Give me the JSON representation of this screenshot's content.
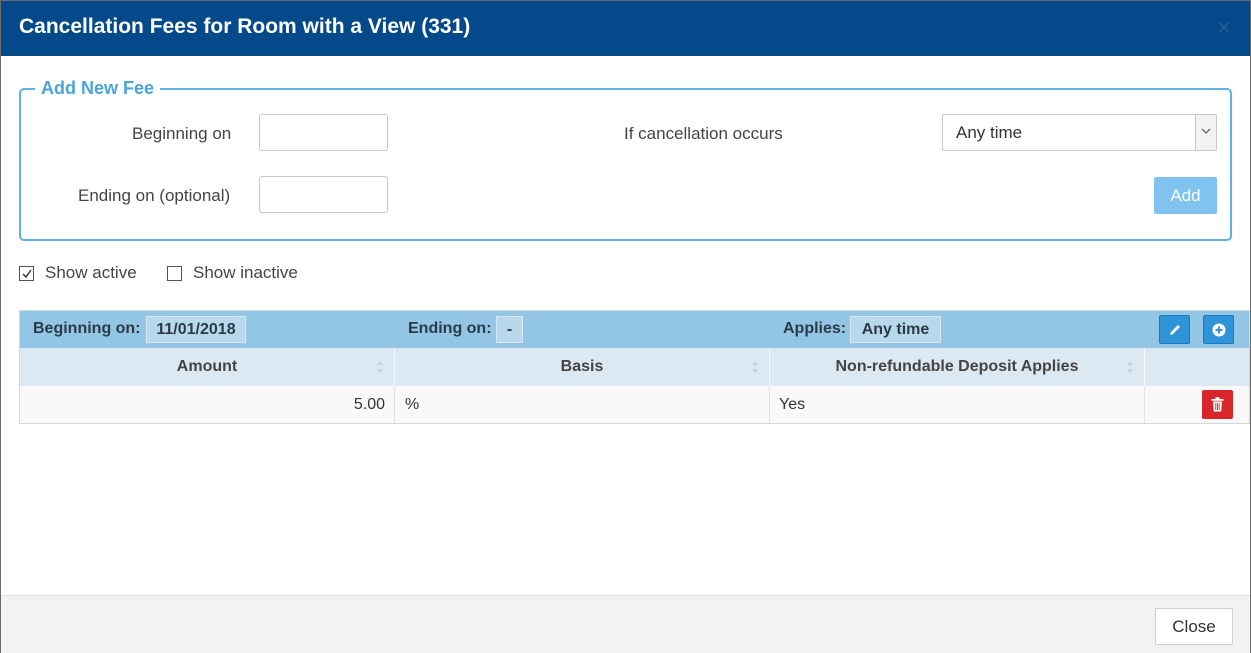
{
  "dialog": {
    "title": "Cancellation Fees for Room with a View (331)",
    "close_icon": "close-icon"
  },
  "add_fee": {
    "legend": "Add New Fee",
    "beginning_label": "Beginning on",
    "beginning_value": "",
    "ending_label": "Ending on (optional)",
    "ending_value": "",
    "cancellation_label": "If cancellation occurs",
    "cancellation_selected": "Any time",
    "add_label": "Add"
  },
  "filters": {
    "show_active_label": "Show active",
    "show_active_checked": true,
    "show_inactive_label": "Show inactive",
    "show_inactive_checked": false
  },
  "fee_group": {
    "beginning_label": "Beginning on:",
    "beginning_value": "11/01/2018",
    "ending_label": "Ending on:",
    "ending_value": "-",
    "applies_label": "Applies:",
    "applies_value": "Any time",
    "edit_icon": "pencil-icon",
    "add_icon": "plus-circle-icon",
    "columns": [
      "Amount",
      "Basis",
      "Non-refundable Deposit Applies"
    ],
    "rows": [
      {
        "amount": "5.00",
        "basis": "%",
        "deposit": "Yes",
        "delete_icon": "trash-icon"
      }
    ]
  },
  "footer": {
    "close_label": "Close"
  },
  "colors": {
    "header_bg": "#04498a",
    "accent": "#4aa4dc",
    "group_bar": "#93c5e5",
    "delete": "#d8262c"
  }
}
